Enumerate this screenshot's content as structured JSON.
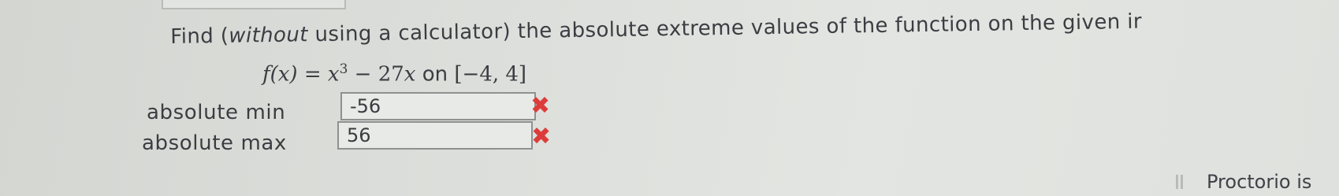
{
  "question": {
    "prompt_part1": "Find (",
    "prompt_emphasis": "without",
    "prompt_part2": " using a calculator) the absolute extreme values of the function on the given ir"
  },
  "formula": {
    "lhs": "f(x) = x",
    "exponent": "3",
    "middle": " − 27",
    "variable": "x",
    "on_word": " on ",
    "interval": "[−4, 4]"
  },
  "answers": [
    {
      "label": "absolute min",
      "value": "-56",
      "status": "incorrect"
    },
    {
      "label": "absolute max",
      "value": "56",
      "status": "incorrect"
    }
  ],
  "incorrect_mark": "✖",
  "proctor": {
    "text": "Proctorio is",
    "icon": "pause-bars-icon"
  },
  "colors": {
    "incorrect": "#dc3d3a",
    "background": "#dcdedb"
  }
}
